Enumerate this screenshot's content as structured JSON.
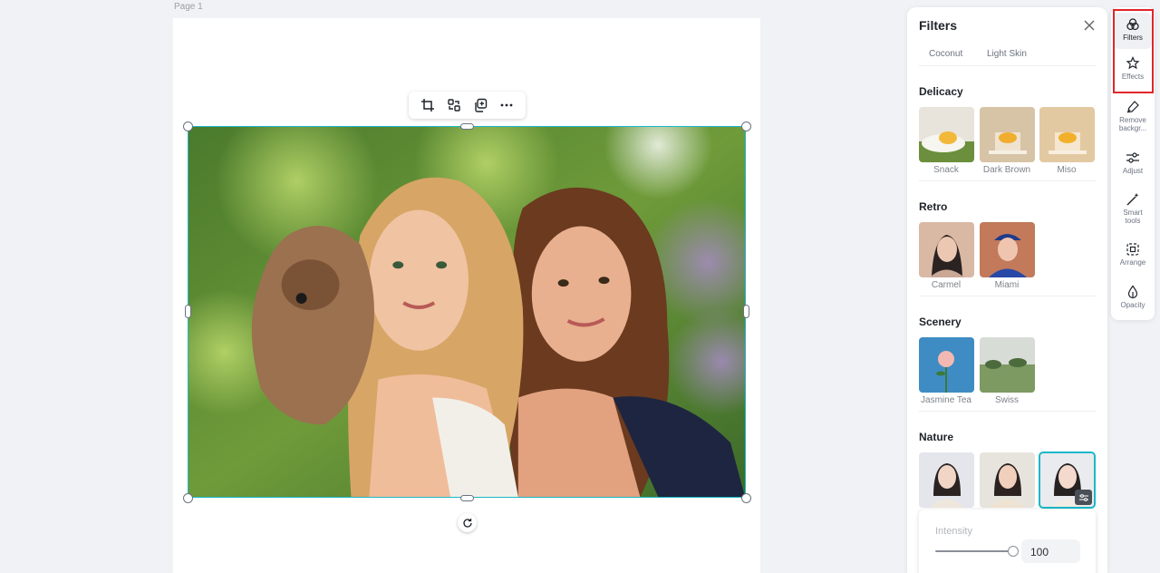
{
  "canvas": {
    "page_label": "Page 1"
  },
  "image_toolbar": {
    "crop_icon": "crop-icon",
    "replace_icon": "replace-icon",
    "duplicate_icon": "duplicate-icon",
    "more_icon": "more-icon"
  },
  "filters_panel": {
    "title": "Filters",
    "partial_row": [
      "Coconut",
      "Light Skin"
    ],
    "sections": [
      {
        "title": "Delicacy",
        "items": [
          "Snack",
          "Dark Brown",
          "Miso"
        ]
      },
      {
        "title": "Retro",
        "items": [
          "Carmel",
          "Miami"
        ]
      },
      {
        "title": "Scenery",
        "items": [
          "Jasmine Tea",
          "Swiss"
        ]
      },
      {
        "title": "Nature",
        "items": [
          "",
          "",
          ""
        ]
      }
    ],
    "intensity": {
      "label": "Intensity",
      "value": "100",
      "level": 1.0
    }
  },
  "tool_rail": {
    "items": [
      {
        "label": "Filters",
        "icon": "filters-icon",
        "active": true
      },
      {
        "label": "Effects",
        "icon": "effects-icon",
        "active": false
      },
      {
        "label": "Remove backgr...",
        "icon": "remove-background-icon",
        "active": false
      },
      {
        "label": "Adjust",
        "icon": "adjust-icon",
        "active": false
      },
      {
        "label": "Smart tools",
        "icon": "smart-tools-icon",
        "active": false
      },
      {
        "label": "Arrange",
        "icon": "arrange-icon",
        "active": false
      },
      {
        "label": "Opacity",
        "icon": "opacity-icon",
        "active": false
      }
    ]
  },
  "colors": {
    "selection": "#19b8c8",
    "highlight": "#e0262a"
  }
}
